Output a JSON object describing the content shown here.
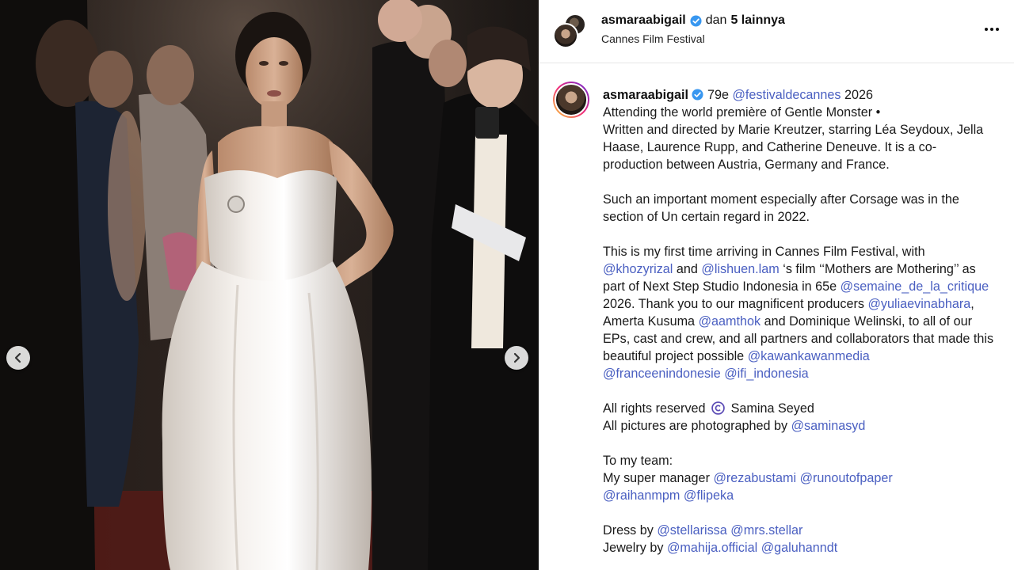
{
  "header": {
    "username": "asmaraabigail",
    "and_text": "dan",
    "others": "5 lainnya",
    "location": "Cannes Film Festival"
  },
  "icons": {
    "verified": "verified-badge-icon",
    "more": "more-options-icon",
    "prev": "chevron-left-icon",
    "next": "chevron-right-icon",
    "copyright": "copyright-icon"
  },
  "colors": {
    "mention": "#4a5fc1",
    "verified": "#3897f0"
  },
  "caption": {
    "l1_user": "asmaraabigail",
    "l1_a": "79e",
    "l1_m1": "@festivaldecannes",
    "l1_b": "2026",
    "l2": "Attending the world première of Gentle Monster •",
    "l3": "Written and directed by Marie Kreutzer, starring Léa Seydoux, Jella",
    "l4": "Haase, Laurence Rupp, and Catherine Deneuve. It is a co-",
    "l5": "production between Austria, Germany and France.",
    "l6": "Such an important moment especially after Corsage was in the",
    "l7": "section of Un certain regard in 2022.",
    "l8": "This is my first time arriving in Cannes Film Festival, with",
    "l9_m1": "@khozyrizal",
    "l9_a": "and",
    "l9_m2": "@lishuen.lam",
    "l9_b": "‘s film ‘‘Mothers are Mothering’’ as",
    "l10_a": "part of Next Step Studio Indonesia in 65e",
    "l10_m1": "@semaine_de_la_critique",
    "l11_a": "2026. Thank you to our magnificent producers",
    "l11_m1": "@yuliaevinabhara",
    "l11_b": ",",
    "l12_a": "Amerta Kusuma",
    "l12_m1": "@aamthok",
    "l12_b": "and Dominique Welinski, to all of our",
    "l13": "EPs, cast and crew, and all partners and collaborators that made this",
    "l14_a": "beautiful project possible",
    "l14_m1": "@kawankawanmedia",
    "l15_m1": "@franceenindonesie",
    "l15_m2": "@ifi_indonesia",
    "l16_a": "All rights reserved",
    "l16_b": "Samina Seyed",
    "l17_a": "All pictures are photographed by",
    "l17_m1": "@saminasyd",
    "l18": "To my team:",
    "l19_a": "My super manager",
    "l19_m1": "@rezabustami",
    "l19_m2": "@runoutofpaper",
    "l20_m1": "@raihanmpm",
    "l20_m2": "@flipeka",
    "l21_a": "Dress by",
    "l21_m1": "@stellarissa",
    "l21_m2": "@mrs.stellar",
    "l22_a": "Jewelry by",
    "l22_m1": "@mahija.official",
    "l22_m2": "@galuhanndt"
  }
}
